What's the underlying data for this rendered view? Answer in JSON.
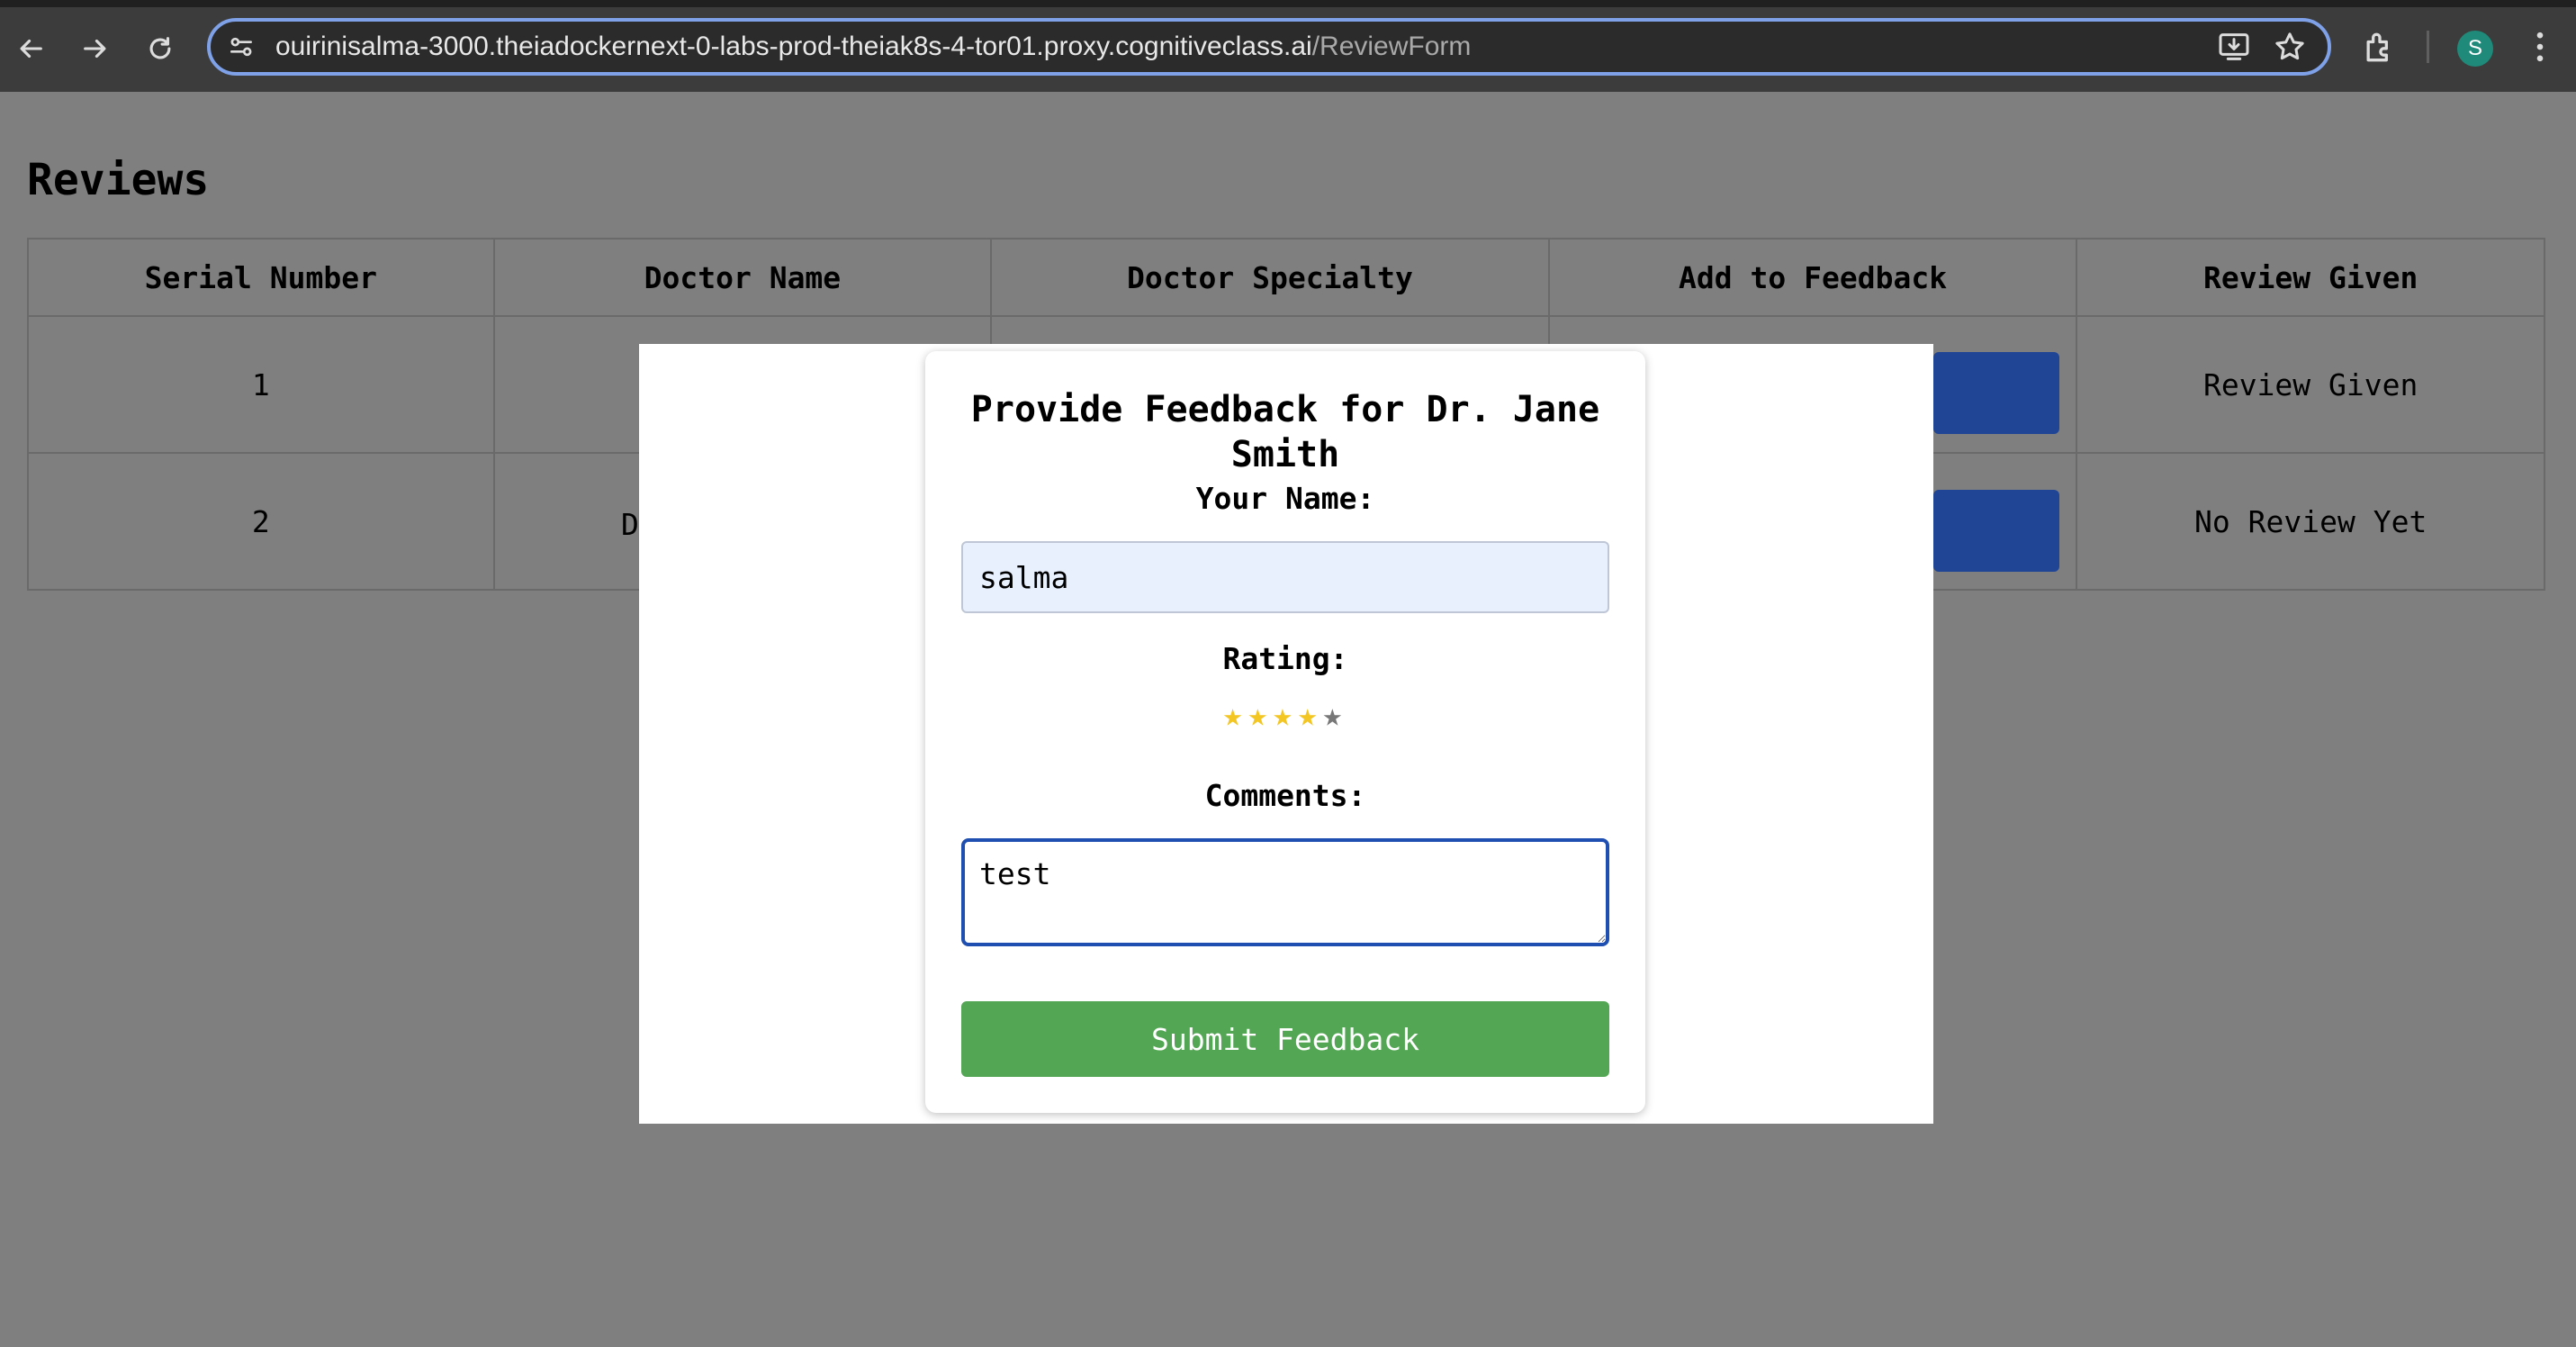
{
  "browser": {
    "url_host": "ouirinisalma-3000.theiadockernext-0-labs-prod-theiak8s-4-tor01.proxy.cognitiveclass.ai",
    "url_path": "/ReviewForm",
    "profile_initial": "S",
    "icons": [
      "back-arrow-icon",
      "forward-arrow-icon",
      "reload-icon",
      "site-info-icon",
      "install-app-icon",
      "bookmark-star-icon",
      "extensions-icon",
      "kebab-menu-icon"
    ]
  },
  "page": {
    "title": "Reviews",
    "table": {
      "headers": [
        "Serial Number",
        "Doctor Name",
        "Doctor Specialty",
        "Add to Feedback",
        "Review Given"
      ],
      "rows": [
        {
          "serial": "1",
          "doctor_visible": "",
          "review": "Review Given"
        },
        {
          "serial": "2",
          "doctor_visible": "D",
          "review": "No Review Yet"
        }
      ]
    }
  },
  "modal": {
    "title": "Provide Feedback for Dr. Jane Smith",
    "name_label": "Your Name:",
    "name_value": "salma",
    "rating_label": "Rating:",
    "rating": 4,
    "rating_max": 5,
    "star_glyph": "★",
    "colors": {
      "star_on": "#f3c623",
      "star_off": "#777777",
      "submit_bg": "#53a653",
      "action_button": "#1f4594"
    },
    "comments_label": "Comments:",
    "comments_value": "test",
    "submit_label": "Submit Feedback"
  }
}
